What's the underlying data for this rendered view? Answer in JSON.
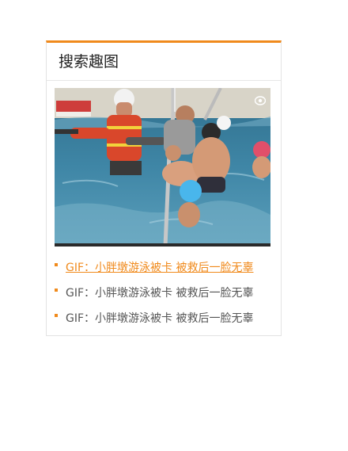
{
  "widget": {
    "title": "搜索趣图",
    "image_alt": "小胖墩游泳被卡 被救后一脸无辜",
    "items": [
      {
        "label": "GIF：小胖墩游泳被卡 被救后一脸无辜",
        "active": true
      },
      {
        "label": "GIF：小胖墩游泳被卡 被救后一脸无辜",
        "active": false
      },
      {
        "label": "GIF：小胖墩游泳被卡 被救后一脸无辜",
        "active": false
      }
    ]
  },
  "colors": {
    "accent": "#f08a1c",
    "text": "#555555",
    "title": "#222222"
  }
}
